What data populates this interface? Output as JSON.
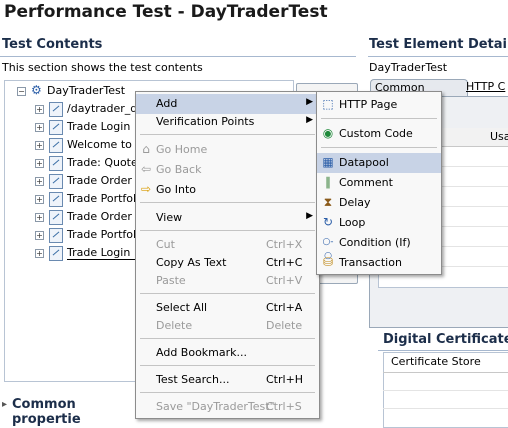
{
  "title": "Performance Test - DayTraderTest",
  "test_contents": {
    "heading": "Test Contents",
    "description": "This section shows the test contents",
    "root": "DayTraderTest",
    "items": [
      "/daytrader_d",
      "Trade Login",
      "Welcome to D",
      "Trade: Quote",
      "Trade Order i",
      "Trade Portfoli",
      "Trade Order i",
      "Trade Portfoli",
      "Trade Login {"
    ],
    "add_button": "Add"
  },
  "common_properties": "Common propertie",
  "test_element_details": {
    "heading": "Test Element Details",
    "name": "DayTraderTest",
    "tabs": [
      "Common Options",
      "HTTP C"
    ],
    "grid_col": "Usa"
  },
  "digital_certificates": {
    "heading": "Digital Certificates",
    "column": "Certificate Store"
  },
  "context_menu": {
    "items": [
      {
        "label": "Add",
        "submenu": true,
        "highlight": true
      },
      {
        "label": "Verification Points",
        "submenu": true
      },
      {
        "label": "Go Home",
        "disabled": true,
        "icon": "home-icon"
      },
      {
        "label": "Go Back",
        "disabled": true,
        "icon": "back-arrow-icon"
      },
      {
        "label": "Go Into",
        "icon": "go-into-icon"
      },
      {
        "label": "View",
        "submenu": true
      },
      {
        "label": "Cut",
        "shortcut": "Ctrl+X",
        "disabled": true
      },
      {
        "label": "Copy As Text",
        "shortcut": "Ctrl+C"
      },
      {
        "label": "Paste",
        "shortcut": "Ctrl+V",
        "disabled": true
      },
      {
        "label": "Select All",
        "shortcut": "Ctrl+A"
      },
      {
        "label": "Delete",
        "shortcut": "Delete",
        "disabled": true
      },
      {
        "label": "Add Bookmark..."
      },
      {
        "label": "Test Search...",
        "shortcut": "Ctrl+H"
      },
      {
        "label": "Save \"DayTraderTest\"",
        "shortcut": "Ctrl+S",
        "disabled": true
      }
    ]
  },
  "add_submenu": {
    "items": [
      {
        "label": "HTTP Page",
        "icon": "http-page-icon"
      },
      {
        "label": "Custom Code",
        "icon": "custom-code-icon"
      },
      {
        "label": "Datapool",
        "icon": "datapool-icon",
        "highlight": true
      },
      {
        "label": "Comment",
        "icon": "comment-icon"
      },
      {
        "label": "Delay",
        "icon": "delay-icon"
      },
      {
        "label": "Loop",
        "icon": "loop-icon"
      },
      {
        "label": "Condition (If)",
        "icon": "condition-icon"
      },
      {
        "label": "Transaction",
        "icon": "transaction-icon"
      }
    ]
  }
}
